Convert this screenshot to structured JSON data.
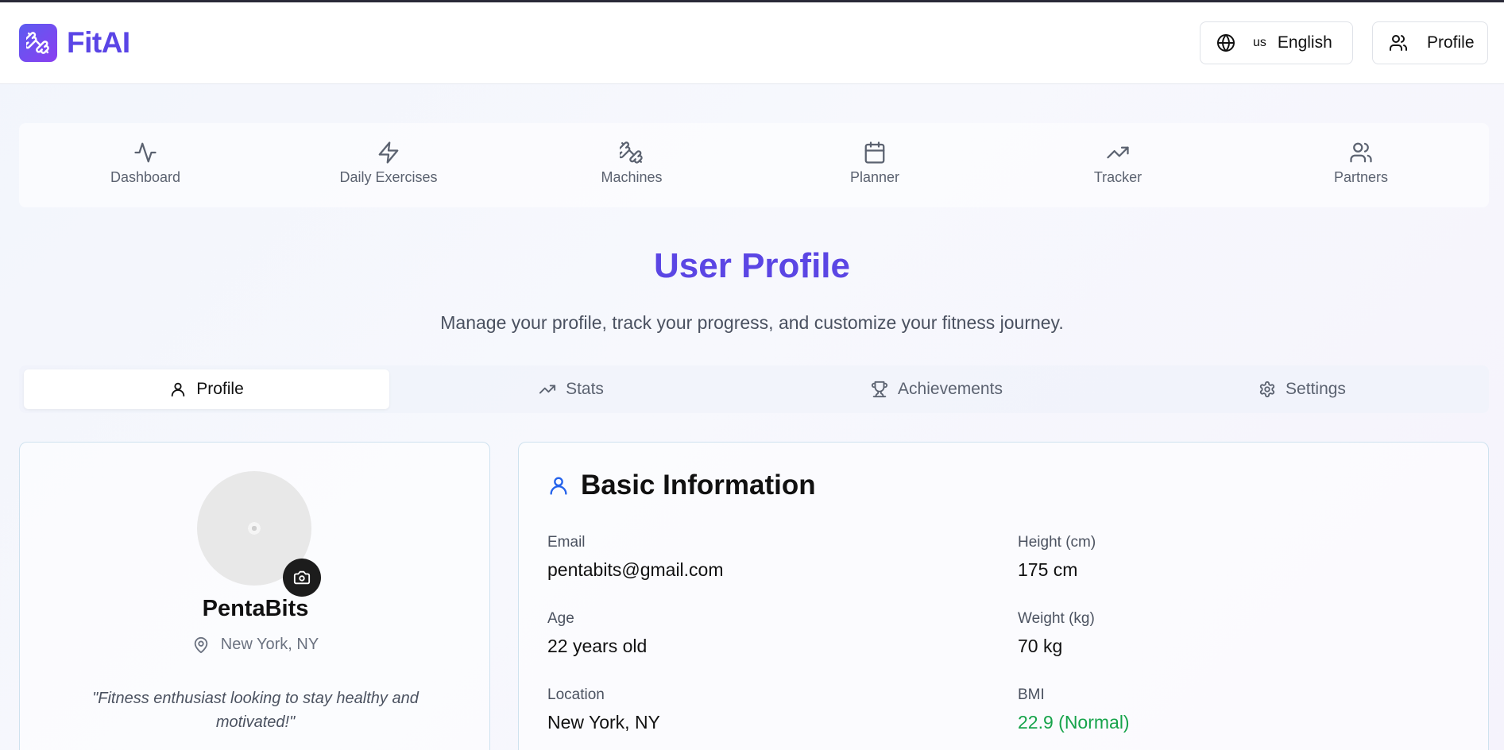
{
  "app": {
    "name": "FitAI"
  },
  "header": {
    "language_flag": "us",
    "language_label": "English",
    "profile_label": "Profile"
  },
  "nav": {
    "items": [
      {
        "label": "Dashboard",
        "icon": "activity-icon"
      },
      {
        "label": "Daily Exercises",
        "icon": "lightning-icon"
      },
      {
        "label": "Machines",
        "icon": "dumbbell-icon"
      },
      {
        "label": "Planner",
        "icon": "calendar-icon"
      },
      {
        "label": "Tracker",
        "icon": "trending-up-icon"
      },
      {
        "label": "Partners",
        "icon": "users-icon"
      }
    ]
  },
  "page": {
    "title": "User Profile",
    "subtitle": "Manage your profile, track your progress, and customize your fitness journey."
  },
  "tabs": {
    "items": [
      {
        "label": "Profile",
        "icon": "user-icon",
        "active": true
      },
      {
        "label": "Stats",
        "icon": "trending-up-icon",
        "active": false
      },
      {
        "label": "Achievements",
        "icon": "trophy-icon",
        "active": false
      },
      {
        "label": "Settings",
        "icon": "gear-icon",
        "active": false
      }
    ]
  },
  "profile_card": {
    "name": "PentaBits",
    "location": "New York, NY",
    "bio": "\"Fitness enthusiast looking to stay healthy and motivated!\""
  },
  "basic_info": {
    "title": "Basic Information",
    "email_label": "Email",
    "email_value": "pentabits@gmail.com",
    "age_label": "Age",
    "age_value": "22 years old",
    "location_label": "Location",
    "location_value": "New York, NY",
    "height_label": "Height (cm)",
    "height_value": "175 cm",
    "weight_label": "Weight (kg)",
    "weight_value": "70 kg",
    "bmi_label": "BMI",
    "bmi_value": "22.9 (Normal)"
  },
  "colors": {
    "brand": "#5b46e4",
    "accent_blue": "#2563eb",
    "bmi_green": "#16a34a",
    "card_border": "#cfe2ef"
  }
}
